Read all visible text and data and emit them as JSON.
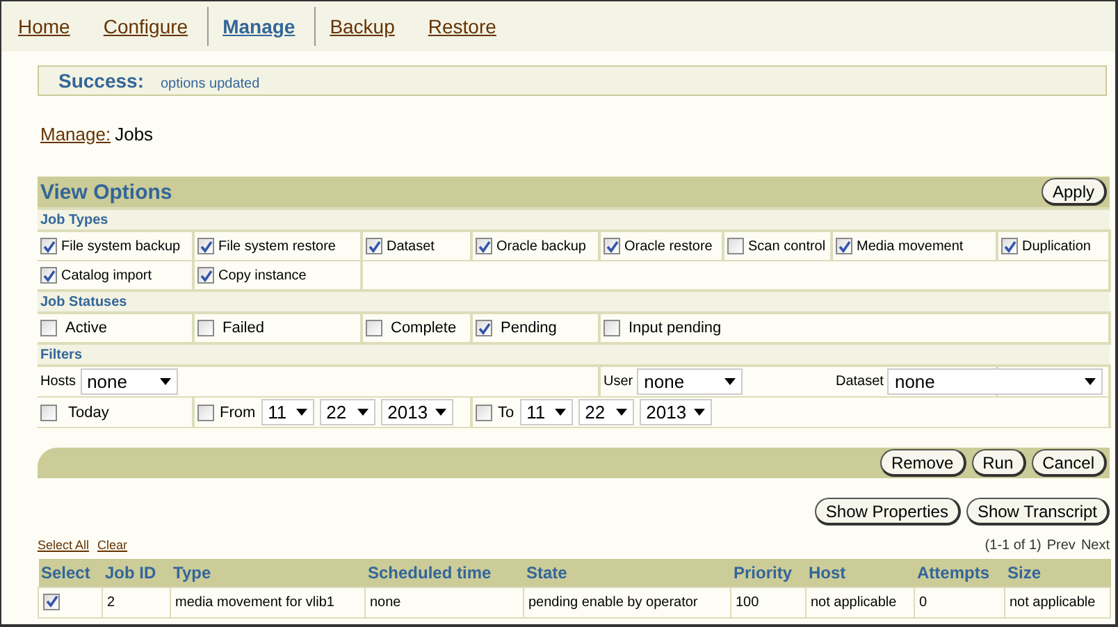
{
  "nav": [
    {
      "label": "Home",
      "selected": false
    },
    {
      "label": "Configure",
      "selected": false
    },
    {
      "label": "Manage",
      "selected": true
    },
    {
      "label": "Backup",
      "selected": false
    },
    {
      "label": "Restore",
      "selected": false
    }
  ],
  "message": {
    "title": "Success:",
    "text": "options updated"
  },
  "breadcrumb": {
    "link": "Manage:",
    "current": "Jobs"
  },
  "view_options": {
    "title": "View Options",
    "apply": "Apply",
    "job_types_heading": "Job Types",
    "job_types": [
      {
        "label": "File system backup",
        "checked": true
      },
      {
        "label": "File system restore",
        "checked": true
      },
      {
        "label": "Dataset",
        "checked": true
      },
      {
        "label": "Oracle backup",
        "checked": true
      },
      {
        "label": "Oracle restore",
        "checked": true
      },
      {
        "label": "Scan control",
        "checked": false
      },
      {
        "label": "Media movement",
        "checked": true
      },
      {
        "label": "Duplication",
        "checked": true
      },
      {
        "label": "Catalog import",
        "checked": true
      },
      {
        "label": "Copy instance",
        "checked": true
      }
    ],
    "job_statuses_heading": "Job Statuses",
    "job_statuses": [
      {
        "label": "Active",
        "checked": false
      },
      {
        "label": "Failed",
        "checked": false
      },
      {
        "label": "Complete",
        "checked": false
      },
      {
        "label": "Pending",
        "checked": true
      },
      {
        "label": "Input pending",
        "checked": false
      }
    ],
    "filters_heading": "Filters",
    "filters": {
      "hosts": {
        "label": "Hosts",
        "value": "none"
      },
      "user": {
        "label": "User",
        "value": "none"
      },
      "dataset": {
        "label": "Dataset",
        "value": "none"
      },
      "today": {
        "label": "Today",
        "checked": false
      },
      "from": {
        "label": "From",
        "checked": false,
        "month": "11",
        "day": "22",
        "year": "2013"
      },
      "to": {
        "label": "To",
        "checked": false,
        "month": "11",
        "day": "22",
        "year": "2013"
      }
    }
  },
  "actions": [
    "Remove",
    "Run",
    "Cancel"
  ],
  "detail_buttons": [
    "Show Properties",
    "Show Transcript"
  ],
  "selection_links": [
    "Select All",
    "Clear"
  ],
  "pagination": {
    "range": "(1-1 of 1)",
    "prev": "Prev",
    "next": "Next"
  },
  "table": {
    "select_column": "Select",
    "columns": [
      "Job ID",
      "Type",
      "Scheduled time",
      "State",
      "Priority",
      "Host",
      "Attempts",
      "Size"
    ],
    "rows": [
      {
        "selected": true,
        "cells": [
          "2",
          "media movement for vlib1",
          "none",
          "pending enable by operator",
          "100",
          "not applicable",
          "0",
          "not applicable"
        ]
      }
    ]
  }
}
